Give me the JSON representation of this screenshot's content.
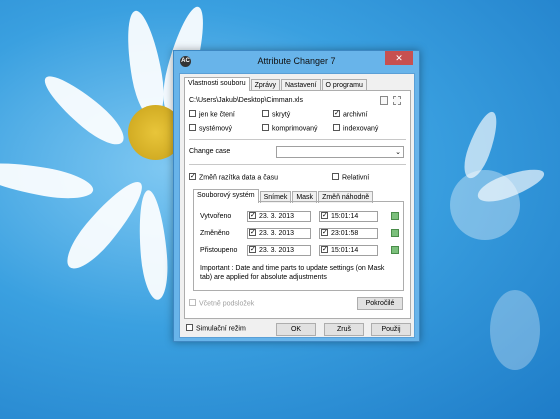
{
  "window": {
    "title": "Attribute Changer 7",
    "close_glyph": "✕",
    "app_icon_glyph": "AC"
  },
  "tabs": [
    {
      "label": "Vlastnosti souboru",
      "active": true
    },
    {
      "label": "Zprávy",
      "active": false
    },
    {
      "label": "Nastavení",
      "active": false
    },
    {
      "label": "O programu",
      "active": false
    }
  ],
  "file_path": "C:\\Users\\Jakub\\Desktop\\Cimman.xls",
  "attributes": [
    {
      "label": "jen ke čtení",
      "checked": false
    },
    {
      "label": "skrytý",
      "checked": false
    },
    {
      "label": "archivní",
      "checked": true
    },
    {
      "label": "systémový",
      "checked": false
    },
    {
      "label": "komprimovaný",
      "checked": false
    },
    {
      "label": "indexovaný",
      "checked": false
    }
  ],
  "change_case": {
    "label": "Change case",
    "value": ""
  },
  "timestamps": {
    "label": "Změň razítka data a času",
    "checked": true
  },
  "relative": {
    "label": "Relativní",
    "checked": false
  },
  "subtabs": [
    {
      "label": "Souborový systém",
      "active": true
    },
    {
      "label": "Snímek",
      "active": false
    },
    {
      "label": "Mask",
      "active": false
    },
    {
      "label": "Změň náhodně",
      "active": false
    }
  ],
  "date_rows": [
    {
      "label": "Vytvořeno",
      "date": "23.  3. 2013",
      "time": "15:01:14"
    },
    {
      "label": "Změněno",
      "date": "23.  3. 2013",
      "time": "23:01:58"
    },
    {
      "label": "Přistoupeno",
      "date": "23.  3. 2013",
      "time": "15:01:14"
    }
  ],
  "note": "Important : Date and time parts to update settings (on Mask tab) are applied for absolute adjustments",
  "include_subfolders": {
    "label": "Včetně podsložek",
    "checked": false
  },
  "advanced_button": "Pokročilé",
  "simulation": {
    "label": "Simulační režim",
    "checked": false
  },
  "buttons": {
    "ok": "OK",
    "cancel": "Zruš",
    "apply": "Použij"
  },
  "glyphs": {
    "dropdown": "⌄",
    "check": "✓"
  },
  "colors": {
    "title_bar": "#68b4ea",
    "close": "#c75050",
    "desktop": "#3aa0e0"
  }
}
